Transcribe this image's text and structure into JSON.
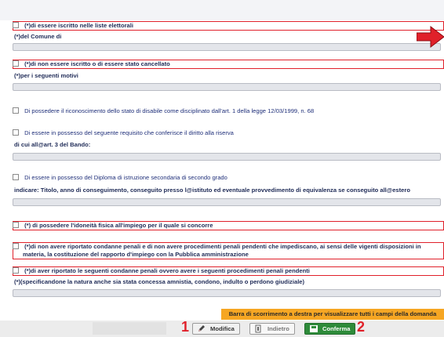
{
  "items": {
    "i1": {
      "label": "(*)di essere iscritto nelle liste elettorali",
      "caption": "(*)del Comune di"
    },
    "i2": {
      "label": "(*)di non essere iscritto o di essere stato cancellato",
      "caption": "(*)per i seguenti motivi"
    },
    "i3": {
      "label": "Di possedere il riconoscimento dello stato di disabile come disciplinato dall'art. 1 della legge 12/03/1999, n. 68"
    },
    "i4": {
      "label": "Di essere in possesso del seguente requisito che conferisce il diritto alla riserva",
      "caption": "di cui all@art. 3 del Bando:"
    },
    "i5": {
      "label": "Di essere in possesso del Diploma di istruzione secondaria di secondo grado",
      "caption": "indicare: Titolo, anno di conseguimento, conseguito presso l@istituto ed eventuale provvedimento di equivalenza se conseguito all@estero"
    },
    "i6": {
      "label": "(*) di possedere l'idoneità fisica all'impiego per il quale si concorre"
    },
    "i7": {
      "label_line1": "(*)di non avere riportato condanne penali e di non avere procedimenti penali pendenti che impediscano, ai sensi delle vigenti disposizioni in",
      "label_line2": "materia, la costituzione del rapporto d'impiego con la Pubblica amministrazione"
    },
    "i8": {
      "label": "(*)di aver riportato le seguenti condanne penali ovvero avere i seguenti procedimenti penali pendenti",
      "caption": "(*)(specificandone la natura anche sia stata concessa amnistia, condono, indulto o perdono giudiziale)"
    }
  },
  "banner": "Barra di scorrimento a destra per visualizzare tutti i campi della domanda",
  "buttons": {
    "modifica": "Modifica",
    "indietro": "Indietro",
    "conferma": "Conferma"
  },
  "annotations": {
    "n1": "1",
    "n2": "2"
  },
  "colors": {
    "required_border": "#e0202a",
    "banner": "#f6a623",
    "confirm": "#2e8b3a",
    "arrow": "#e0202a"
  },
  "icons": {
    "arrow": "right-arrow-icon",
    "modifica": "pencil-icon",
    "indietro": "back-icon",
    "conferma": "save-icon"
  }
}
